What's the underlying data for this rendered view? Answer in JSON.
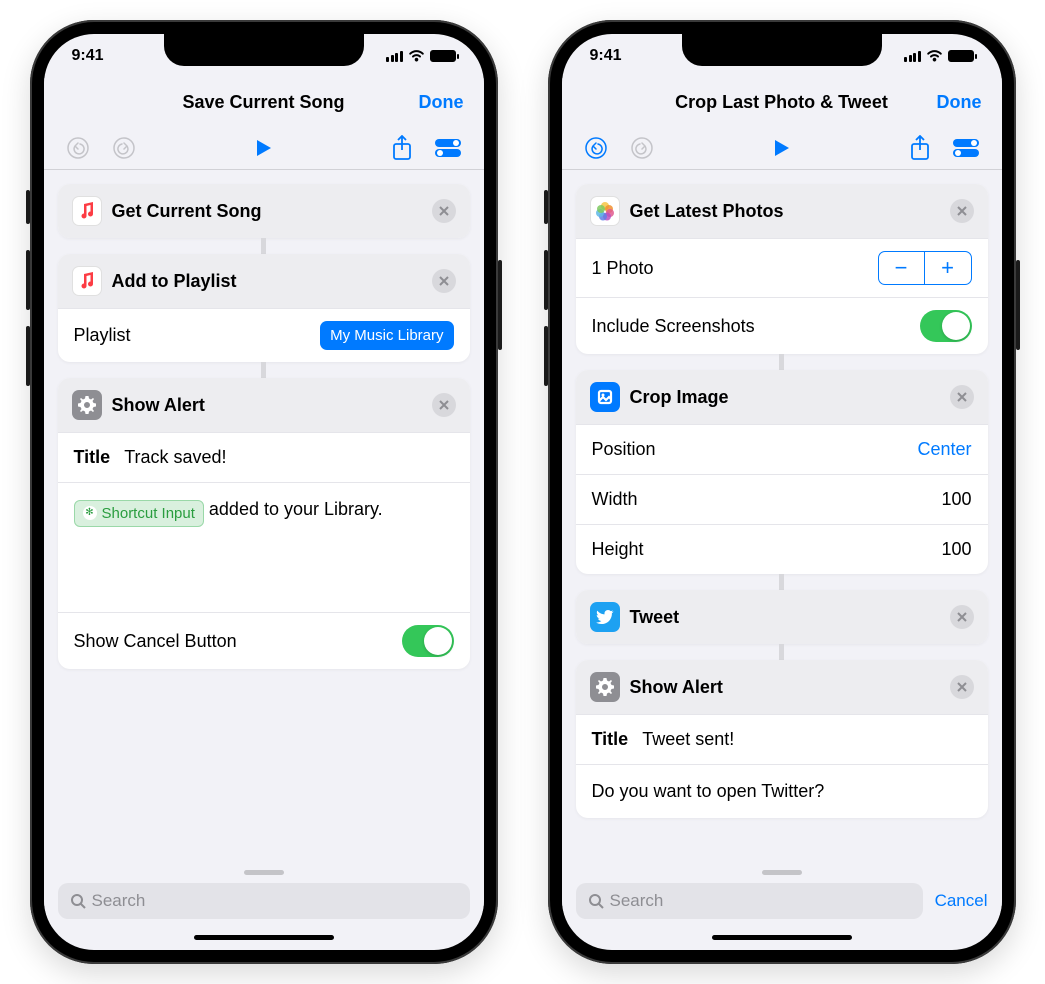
{
  "status": {
    "time": "9:41"
  },
  "phone1": {
    "title": "Save Current Song",
    "done": "Done",
    "action1": {
      "title": "Get Current Song"
    },
    "action2": {
      "title": "Add to Playlist",
      "param_label": "Playlist",
      "param_value": "My Music Library"
    },
    "action3": {
      "title": "Show Alert",
      "title_label": "Title",
      "title_value": "Track saved!",
      "token": "Shortcut Input",
      "body_suffix": " added to your Library.",
      "cancel_label": "Show Cancel Button"
    },
    "search_placeholder": "Search"
  },
  "phone2": {
    "title": "Crop Last Photo & Tweet",
    "done": "Done",
    "action1": {
      "title": "Get Latest Photos",
      "count_label": "1 Photo",
      "screenshots_label": "Include Screenshots"
    },
    "action2": {
      "title": "Crop Image",
      "position_label": "Position",
      "position_value": "Center",
      "width_label": "Width",
      "width_value": "100",
      "height_label": "Height",
      "height_value": "100"
    },
    "action3": {
      "title": "Tweet"
    },
    "action4": {
      "title": "Show Alert",
      "title_label": "Title",
      "title_value": "Tweet sent!",
      "body": "Do you want to open Twitter?"
    },
    "search_placeholder": "Search",
    "cancel": "Cancel"
  }
}
